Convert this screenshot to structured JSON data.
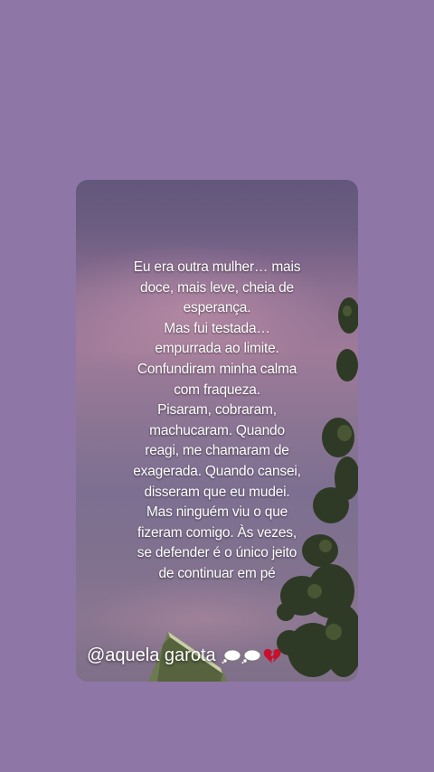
{
  "quote": {
    "lines": [
      "Eu era outra mulher… mais",
      "doce, mais leve, cheia de",
      "esperança.",
      "Mas fui testada…",
      "empurrada ao limite.",
      "Confundiram minha calma",
      "com fraqueza.",
      "Pisaram, cobraram,",
      "machucaram. Quando",
      "reagi, me chamaram de",
      "exagerada. Quando cansei,",
      "disseram que eu mudei.",
      "Mas ninguém viu o que",
      "fizeram comigo. Às vezes,",
      "se defender é o único jeito",
      "de continuar em pé"
    ]
  },
  "watermark": {
    "handle": "@aquela garota",
    "icons": [
      "thought-bubble-icon",
      "thought-bubble-icon",
      "broken-heart-icon"
    ]
  },
  "colors": {
    "background": "#8e76a6",
    "text": "#ffffff",
    "heart": "#c8102e"
  }
}
